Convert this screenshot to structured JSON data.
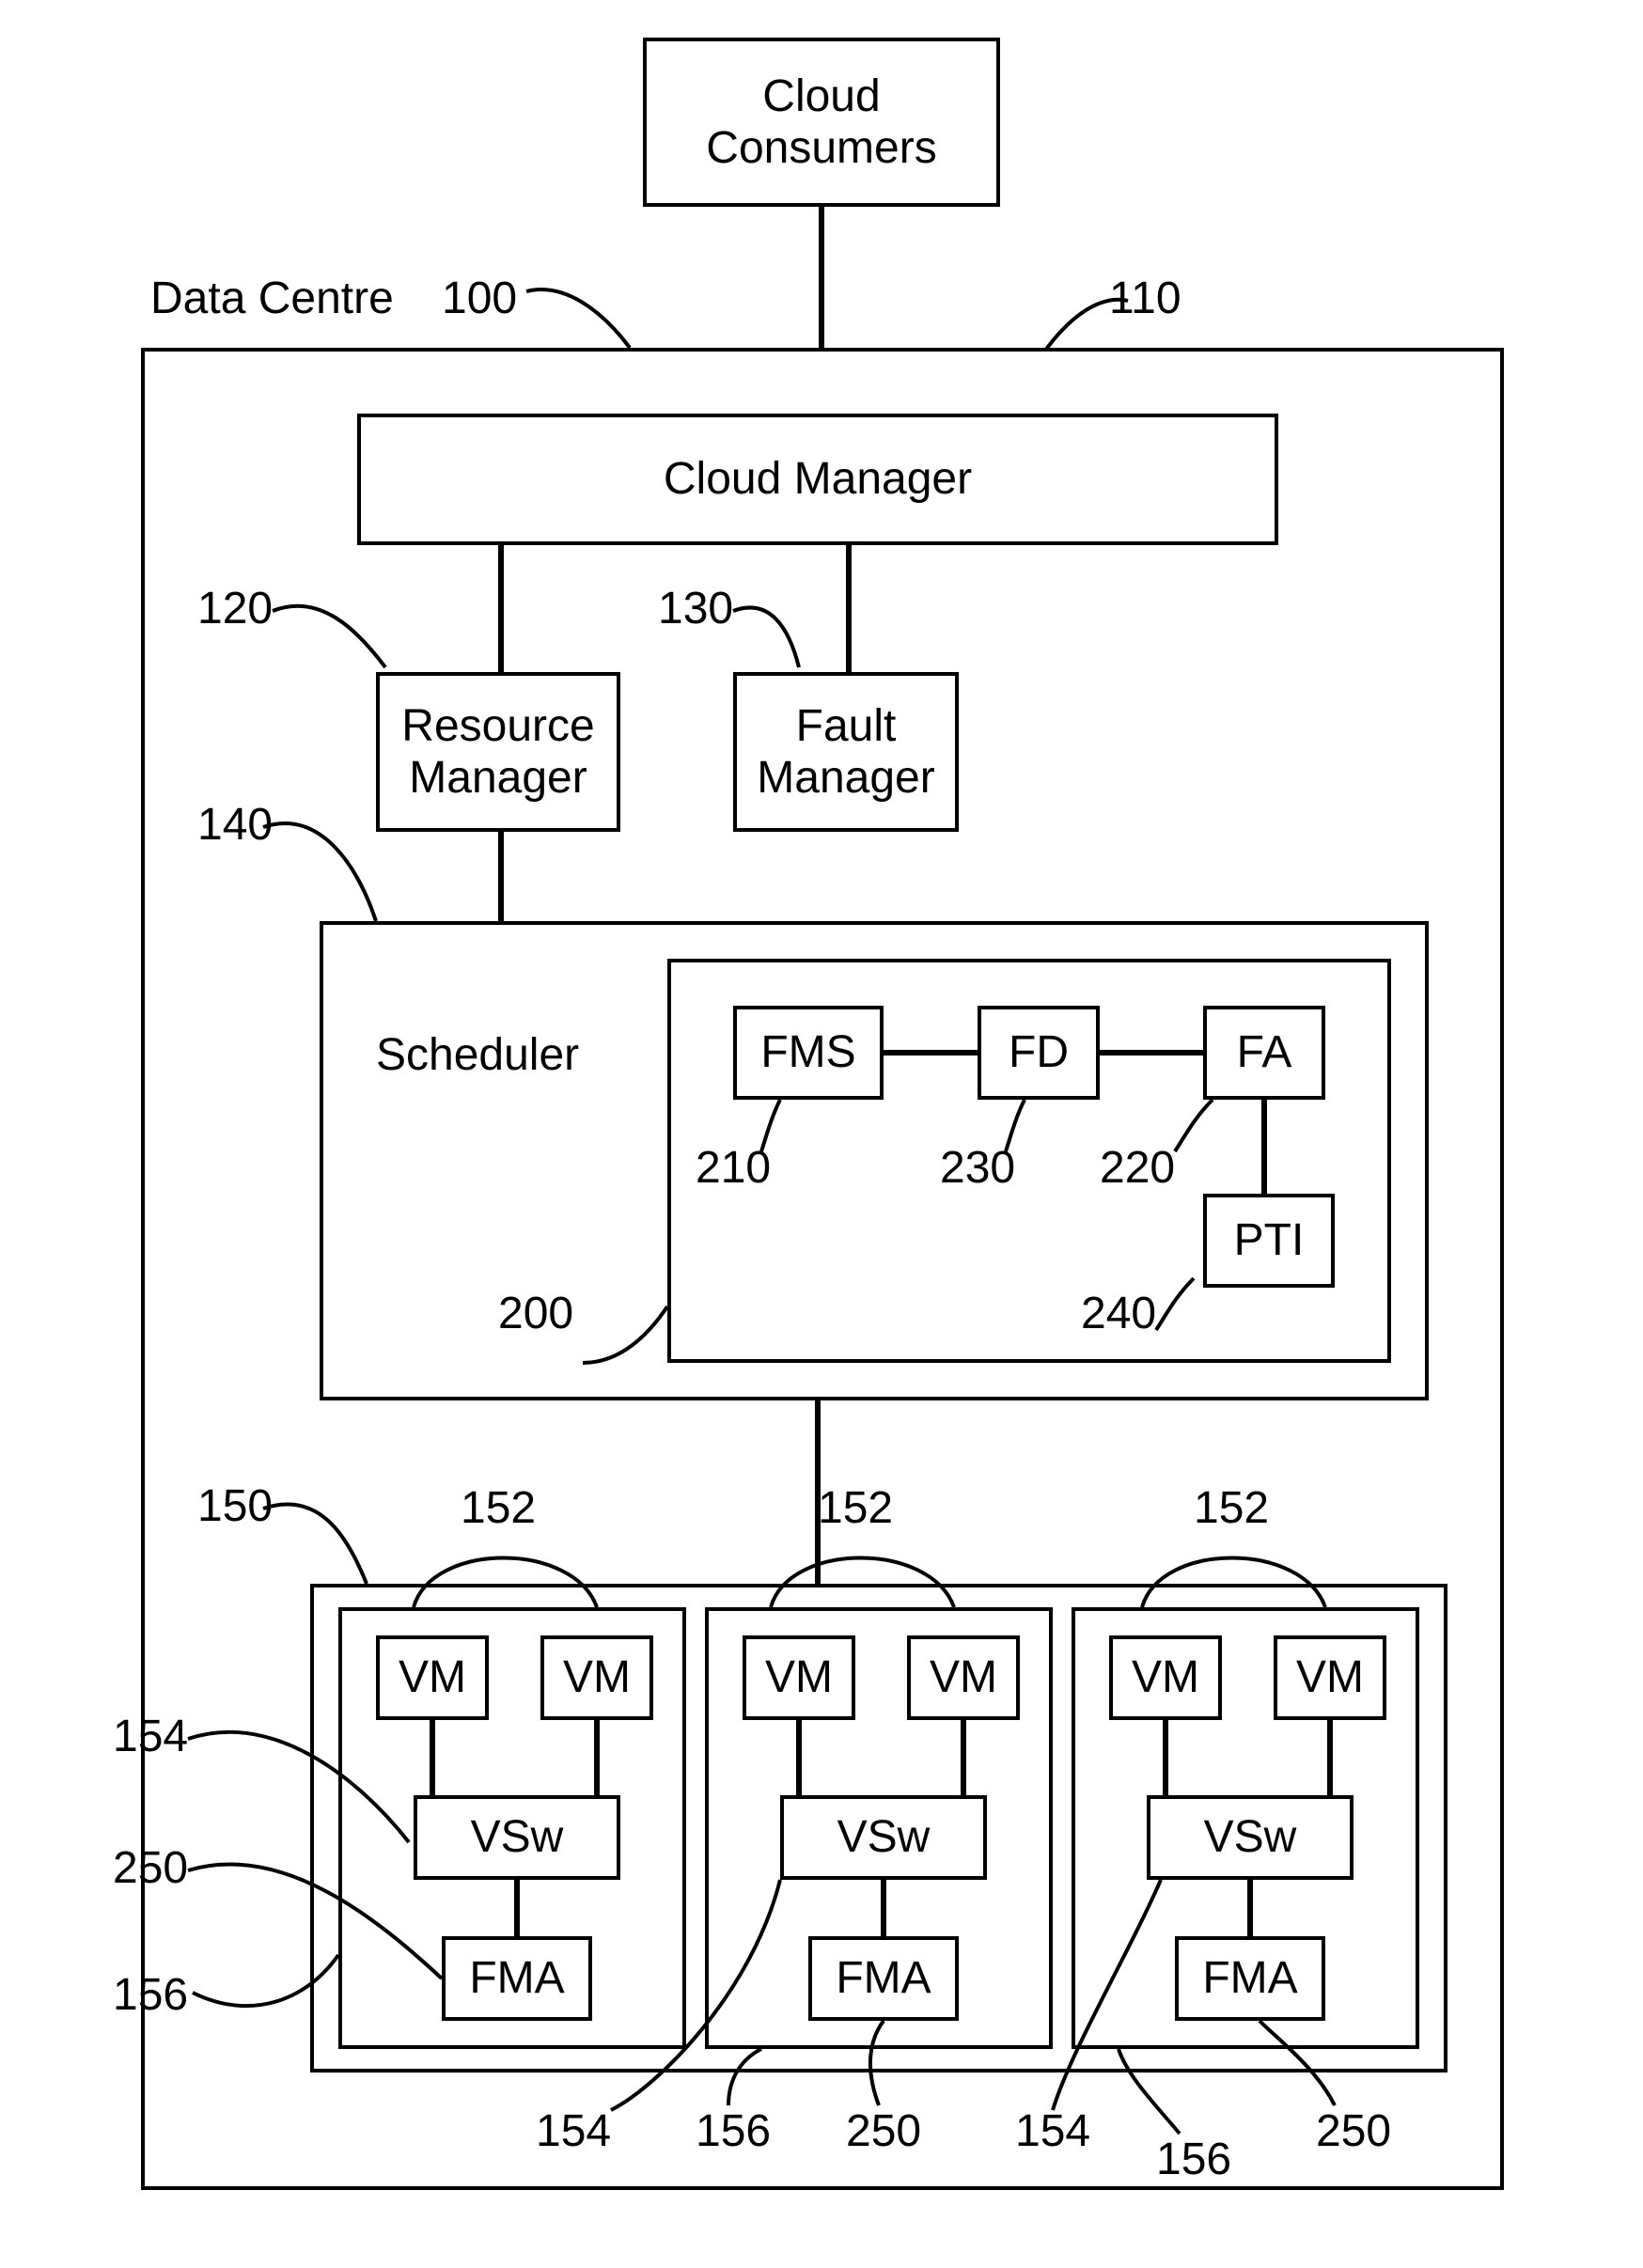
{
  "top": {
    "cloud_consumers": "Cloud\nConsumers"
  },
  "labels": {
    "data_centre": "Data Centre",
    "100": "100",
    "110": "110",
    "120": "120",
    "130": "130",
    "140": "140",
    "150": "150",
    "152a": "152",
    "152b": "152",
    "152c": "152",
    "154a": "154",
    "154b": "154",
    "154c": "154",
    "156a": "156",
    "156b": "156",
    "156c": "156",
    "250a": "250",
    "250b": "250",
    "250c": "250",
    "200": "200",
    "210": "210",
    "220": "220",
    "230": "230",
    "240": "240",
    "scheduler": "Scheduler"
  },
  "boxes": {
    "cloud_manager": "Cloud Manager",
    "resource_manager": "Resource\nManager",
    "fault_manager": "Fault\nManager",
    "fms": "FMS",
    "fd": "FD",
    "fa": "FA",
    "pti": "PTI",
    "vm": "VM",
    "vsw": "VSw",
    "fma": "FMA"
  }
}
